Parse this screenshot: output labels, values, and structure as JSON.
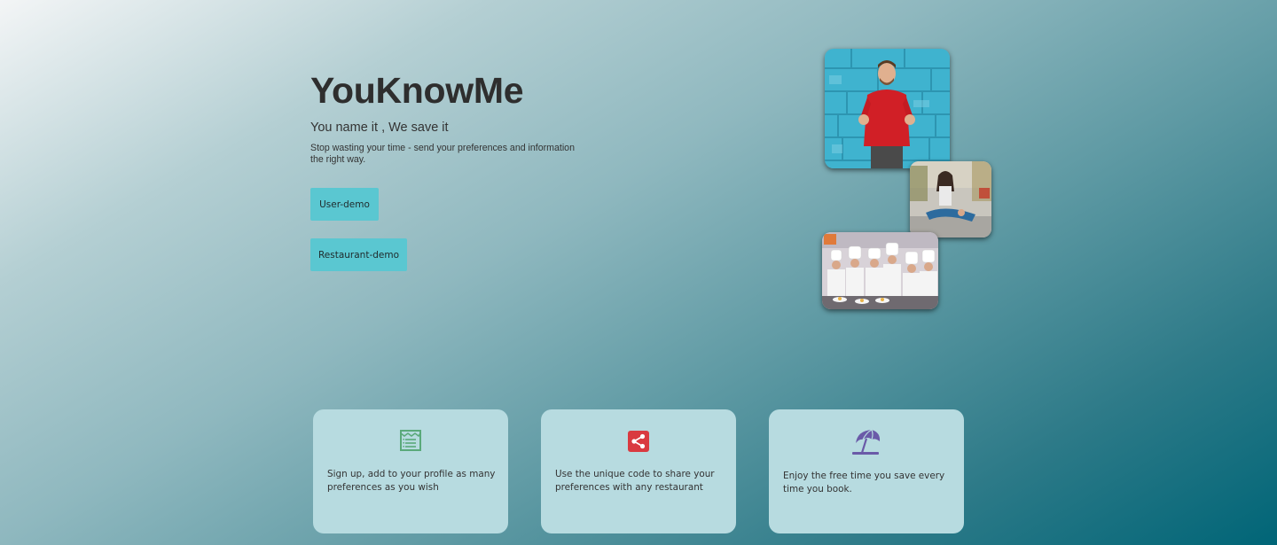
{
  "hero": {
    "title": "YouKnowMe",
    "subtitle": "You name it , We save it",
    "description": "Stop wasting your time - send your preferences and information the right way."
  },
  "buttons": {
    "user_demo": "User-demo",
    "restaurant_demo": "Restaurant-demo"
  },
  "photos": [
    {
      "subject": "man-in-red-sweater-photo"
    },
    {
      "subject": "woman-sitting-photo"
    },
    {
      "subject": "chefs-team-photo"
    }
  ],
  "features": [
    {
      "icon": "menu-list-icon",
      "color": "#5aa97a",
      "text": "Sign up, add to your profile as many preferences as you wish"
    },
    {
      "icon": "share-icon",
      "color": "#d93a40",
      "text": "Use the unique code to share your preferences with any restaurant"
    },
    {
      "icon": "beach-umbrella-icon",
      "color": "#6a5aa8",
      "text": "Enjoy the free time you save every time you book."
    }
  ],
  "colors": {
    "button_bg": "#5ac7d1",
    "card_bg": "#b7dbe0",
    "gradient_start": "#f3f5f6",
    "gradient_end": "#006577"
  }
}
